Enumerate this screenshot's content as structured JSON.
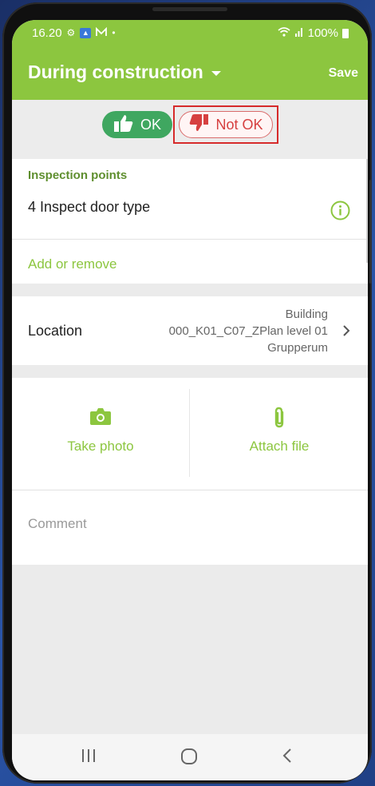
{
  "status_bar": {
    "time": "16.20",
    "battery": "100%",
    "icons": [
      "gear-icon",
      "app-badge-icon",
      "mail-icon",
      "dot-icon",
      "wifi-icon",
      "signal-icon",
      "battery-icon"
    ]
  },
  "app_bar": {
    "title": "During construction",
    "save_label": "Save"
  },
  "status_toggle": {
    "ok_label": "OK",
    "not_ok_label": "Not OK"
  },
  "inspection": {
    "header": "Inspection points",
    "item": "4 Inspect door type",
    "add_remove": "Add or remove"
  },
  "location": {
    "label": "Location",
    "line1": "Building",
    "line2": "000_K01_C07_ZPlan level 01",
    "line3": "Grupperum"
  },
  "attachments": {
    "take_photo": "Take photo",
    "attach_file": "Attach file"
  },
  "comment": {
    "placeholder": "Comment"
  },
  "colors": {
    "brand_green": "#8cc63f",
    "ok_green": "#3fa760",
    "not_ok_red": "#d64040",
    "header_green": "#5f8f2f"
  }
}
